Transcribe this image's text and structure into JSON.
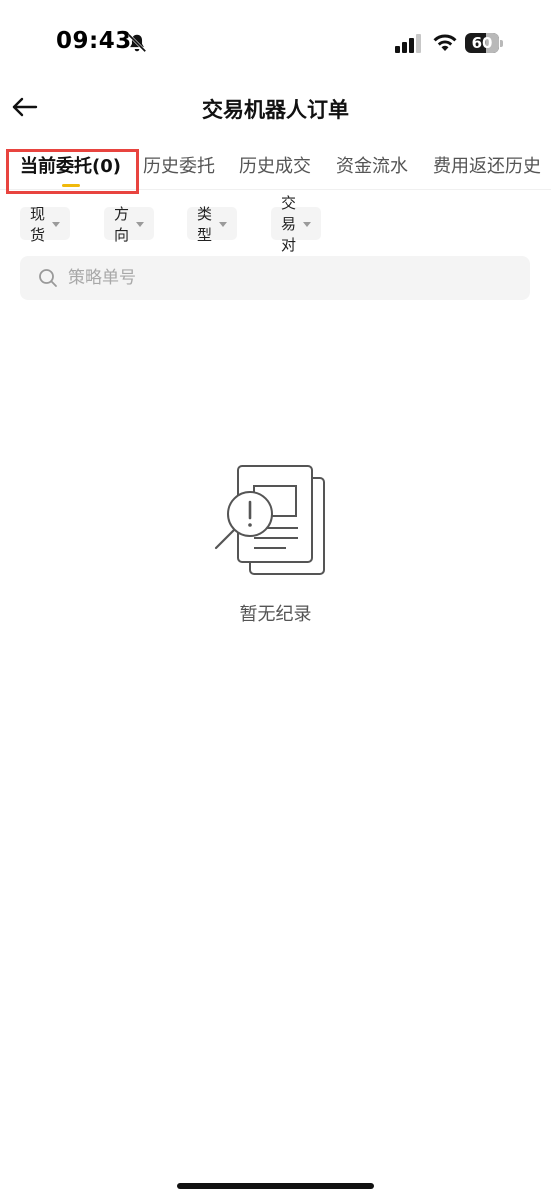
{
  "status_bar": {
    "time": "09:43",
    "battery_level": "60",
    "icons": [
      "bell-slash-icon",
      "signal-icon",
      "wifi-icon",
      "battery-icon"
    ]
  },
  "header": {
    "back_icon": "arrow-left-icon",
    "title": "交易机器人订单"
  },
  "tabs": [
    {
      "label": "当前委托(0)",
      "active": true
    },
    {
      "label": "历史委托",
      "active": false
    },
    {
      "label": "历史成交",
      "active": false
    },
    {
      "label": "资金流水",
      "active": false
    },
    {
      "label": "费用返还历史",
      "active": false
    }
  ],
  "filters": [
    {
      "label": "现货"
    },
    {
      "label": "方向"
    },
    {
      "label": "类型"
    },
    {
      "label": "交易对"
    }
  ],
  "search": {
    "placeholder": "策略单号",
    "value": ""
  },
  "empty_state": {
    "icon": "no-records-document-icon",
    "text": "暂无纪录"
  },
  "colors": {
    "accent": "#f0b90b",
    "highlight_box": "#e8443f",
    "chip_bg": "#f4f4f4"
  }
}
